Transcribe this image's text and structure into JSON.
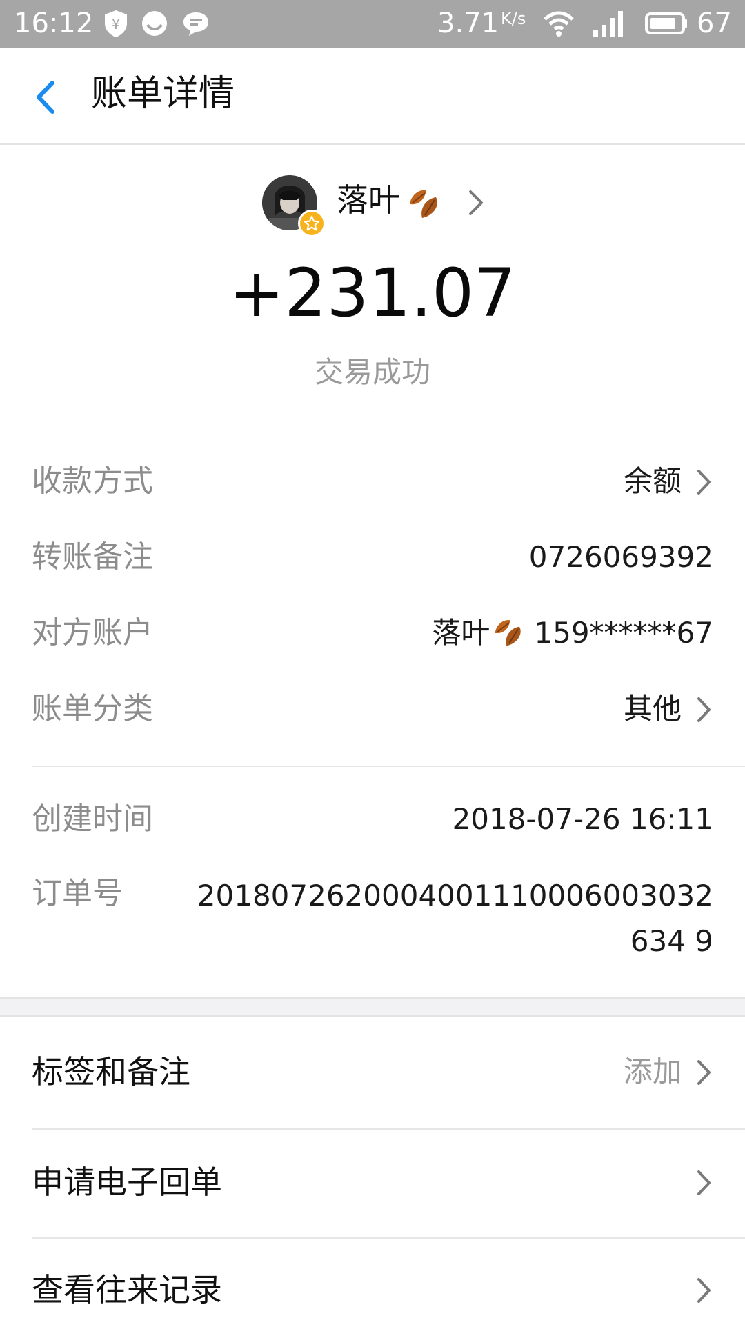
{
  "status_bar": {
    "time": "16:12",
    "net_speed": "3.71",
    "net_speed_unit": "K/s",
    "battery": "67",
    "icons": [
      "shield-yen-icon",
      "face-icon",
      "chat-bubble-icon",
      "wifi-icon",
      "signal-icon",
      "battery-icon"
    ]
  },
  "header": {
    "title": "账单详情",
    "back_icon": "chevron-left-icon"
  },
  "counterparty": {
    "name": "落叶",
    "avatar_badge_icon": "star-badge-icon"
  },
  "transaction": {
    "amount": "+231.07",
    "status": "交易成功"
  },
  "details": [
    {
      "label": "收款方式",
      "value": "余额"
    },
    {
      "label": "转账备注",
      "value": "0726069392"
    },
    {
      "label": "对方账户",
      "name": "落叶",
      "value": "159******67"
    },
    {
      "label": "账单分类",
      "value": "其他"
    }
  ],
  "meta": {
    "created_label": "创建时间",
    "created_value": "2018-07-26 16:11",
    "order_label": "订单号",
    "order_value": "2018072620004001110006003032634 9"
  },
  "actions": [
    {
      "label": "标签和备注",
      "hint": "添加"
    },
    {
      "label": "申请电子回单",
      "hint": ""
    },
    {
      "label": "查看往来记录",
      "hint": ""
    }
  ],
  "colors": {
    "accent_blue": "#1a8cf0",
    "status_bar_bg": "#a6a6a6",
    "muted_text": "#8c8c8c",
    "divider": "#e6e6e6",
    "badge_yellow": "#f7b31d",
    "leaf_brown": "#c0651e"
  }
}
